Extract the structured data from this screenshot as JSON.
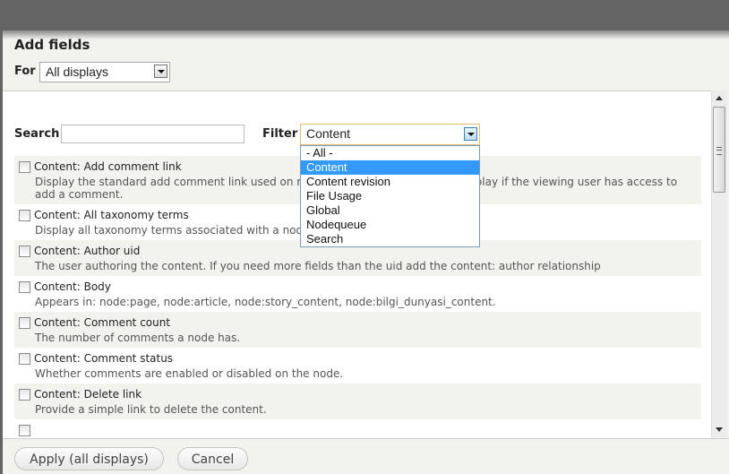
{
  "dialog": {
    "title": "Add fields",
    "for_label": "For",
    "for_value": "All displays"
  },
  "search": {
    "label": "Search",
    "value": "",
    "placeholder": ""
  },
  "filter": {
    "label": "Filter",
    "value": "Content",
    "options": [
      "- All -",
      "Content",
      "Content revision",
      "File Usage",
      "Global",
      "Nodequeue",
      "Search"
    ],
    "selected_index": 1,
    "highlight_color": "#3399ff"
  },
  "fields": [
    {
      "name": "Content: Add comment link",
      "description": "Display the standard add comment link used on regular nodes, which will only display if the viewing user has access to add a comment.",
      "checked": false
    },
    {
      "name": "Content: All taxonomy terms",
      "description": "Display all taxonomy terms associated with a node from specified vocabularies.",
      "checked": false
    },
    {
      "name": "Content: Author uid",
      "description": "The user authoring the content. If you need more fields than the uid add the content: author relationship",
      "checked": false
    },
    {
      "name": "Content: Body",
      "description": "Appears in: node:page, node:article, node:story_content, node:bilgi_dunyasi_content.",
      "checked": false
    },
    {
      "name": "Content: Comment count",
      "description": "The number of comments a node has.",
      "checked": false
    },
    {
      "name": "Content: Comment status",
      "description": "Whether comments are enabled or disabled on the node.",
      "checked": false
    },
    {
      "name": "Content: Delete link",
      "description": "Provide a simple link to delete the content.",
      "checked": false
    }
  ],
  "footer": {
    "apply_label": "Apply (all displays)",
    "cancel_label": "Cancel"
  }
}
